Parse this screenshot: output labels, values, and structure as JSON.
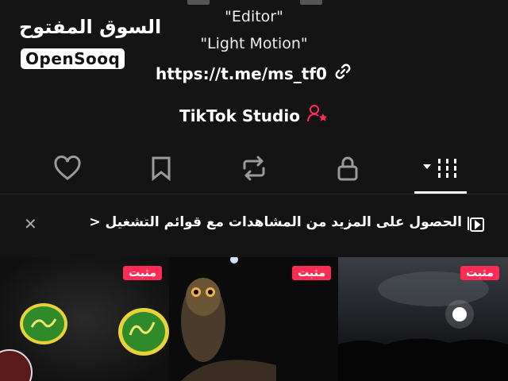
{
  "watermark": {
    "arabic": "السوق المفتوح",
    "english": "OpenSooq"
  },
  "profile": {
    "bio_line_1": "\"Editor\"",
    "bio_line_2": "\"Light Motion\"",
    "link": "https://t.me/ms_tf0",
    "studio_label": "TikTok Studio"
  },
  "tabs": [
    {
      "name": "liked",
      "icon": "heart-icon"
    },
    {
      "name": "favorites",
      "icon": "bookmark-icon"
    },
    {
      "name": "reposts",
      "icon": "repost-icon"
    },
    {
      "name": "private",
      "icon": "lock-icon"
    },
    {
      "name": "videos",
      "icon": "grid-icon",
      "active": true
    }
  ],
  "promo": {
    "text": "الحصول على المزيد من المشاهدات مع قوائم التشغيل",
    "chevron": "<"
  },
  "videos": [
    {
      "pinned_label": "مثبت"
    },
    {
      "pinned_label": "مثبت"
    },
    {
      "pinned_label": "مثبت"
    }
  ],
  "colors": {
    "accent": "#fe2c55",
    "background": "#141414"
  }
}
